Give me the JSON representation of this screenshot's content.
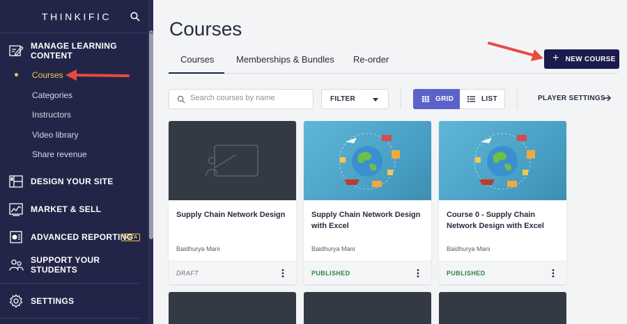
{
  "sidebar": {
    "logo": "THINKIFIC",
    "sections": [
      {
        "label": "MANAGE LEARNING CONTENT",
        "icon": "edit-content-icon"
      },
      {
        "label": "DESIGN YOUR SITE",
        "icon": "layout-icon"
      },
      {
        "label": "MARKET & SELL",
        "icon": "chart-icon"
      },
      {
        "label": "ADVANCED REPORTING",
        "icon": "report-icon",
        "badge": "BETA"
      },
      {
        "label": "SUPPORT YOUR STUDENTS",
        "icon": "students-icon"
      },
      {
        "label": "SETTINGS",
        "icon": "gear-icon"
      }
    ],
    "subitems": [
      "Courses",
      "Categories",
      "Instructors",
      "Video library",
      "Share revenue"
    ]
  },
  "header": {
    "title": "Courses",
    "tabs": [
      "Courses",
      "Memberships & Bundles",
      "Re-order"
    ],
    "new_course": "NEW COURSE"
  },
  "toolbar": {
    "search_placeholder": "Search courses by name",
    "filter": "FILTER",
    "grid": "GRID",
    "list": "LIST",
    "player_settings": "PLAYER SETTINGS"
  },
  "courses": [
    {
      "title": "Supply Chain Network Design",
      "author": "Baidhurya Mani",
      "status": "DRAFT"
    },
    {
      "title": "Supply Chain Network Design with Excel",
      "author": "Baidhurya Mani",
      "status": "PUBLISHED"
    },
    {
      "title": "Course 0 - Supply Chain Network Design with Excel",
      "author": "Baidhurya Mani",
      "status": "PUBLISHED"
    }
  ],
  "colors": {
    "sidebar_bg": "#232548",
    "accent_yellow": "#f2c94c",
    "primary_button": "#1b1c4d",
    "grid_active": "#5b62c9",
    "published_green": "#2e8540",
    "annotation_arrow": "#e84a3f"
  }
}
